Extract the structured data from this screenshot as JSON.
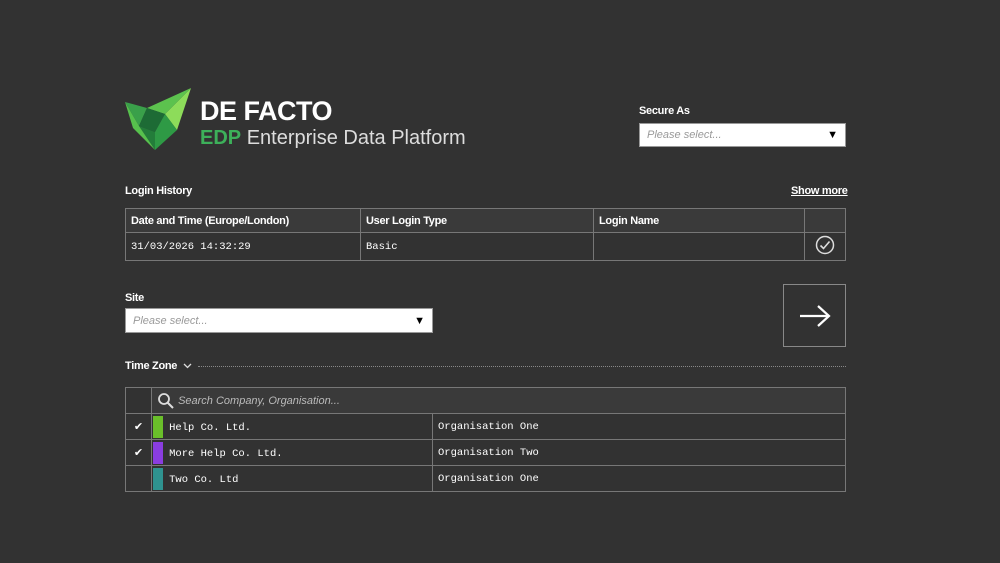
{
  "brand": {
    "name": "DE FACTO",
    "edp": "EDP",
    "subtitle": "Enterprise Data Platform"
  },
  "secure_as": {
    "label": "Secure As",
    "placeholder": "Please select..."
  },
  "login_history": {
    "title": "Login History",
    "show_more": "Show more",
    "columns": [
      "Date and Time (Europe/London)",
      "User Login Type",
      "Login Name",
      ""
    ],
    "rows": [
      {
        "datetime": "31/03/2026 14:32:29",
        "type": "Basic",
        "name": "",
        "icon": "check-circle-icon"
      }
    ]
  },
  "site": {
    "label": "Site",
    "placeholder": "Please select..."
  },
  "time_zone": {
    "label": "Time Zone"
  },
  "companies": {
    "search_placeholder": "Search Company, Organisation...",
    "rows": [
      {
        "checked": true,
        "color": "#6abf2a",
        "company": "Help Co. Ltd.",
        "org": "Organisation One"
      },
      {
        "checked": true,
        "color": "#8a3de0",
        "company": "More Help Co. Ltd.",
        "org": "Organisation Two"
      },
      {
        "checked": false,
        "color": "#2f9390",
        "company": "Two Co. Ltd",
        "org": "Organisation One"
      }
    ]
  }
}
